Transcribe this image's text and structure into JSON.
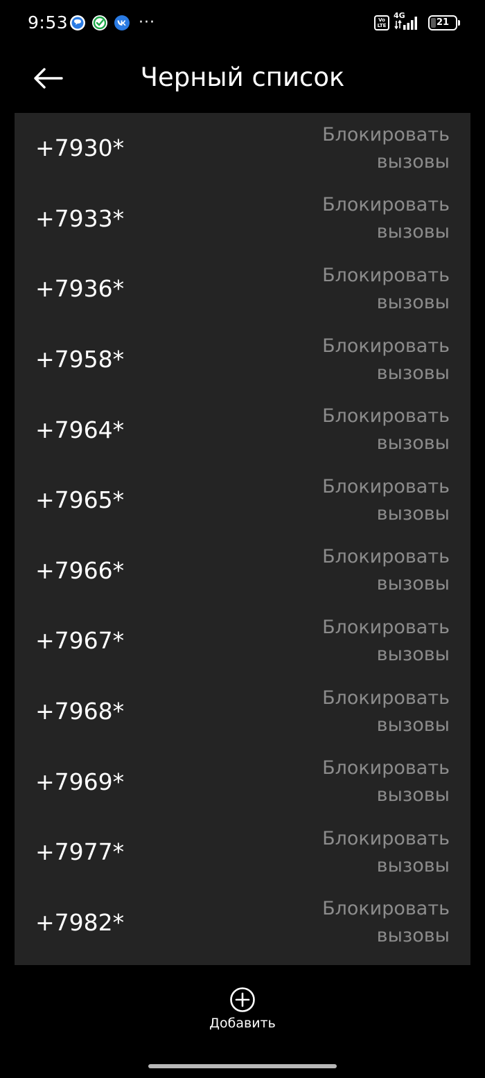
{
  "status_bar": {
    "time": "9:53",
    "network_type": "4G",
    "volte_label": "Vo LTE",
    "battery_level": "21",
    "notification_icons": [
      "chat-bubble-icon",
      "green-check-icon",
      "vk-icon"
    ],
    "more_indicator": "···"
  },
  "header": {
    "back_icon": "arrow-left-icon",
    "title": "Черный список"
  },
  "blacklist": {
    "items": [
      {
        "number": "+7930*",
        "action": "Блокировать вызовы"
      },
      {
        "number": "+7933*",
        "action": "Блокировать вызовы"
      },
      {
        "number": "+7936*",
        "action": "Блокировать вызовы"
      },
      {
        "number": "+7958*",
        "action": "Блокировать вызовы"
      },
      {
        "number": "+7964*",
        "action": "Блокировать вызовы"
      },
      {
        "number": "+7965*",
        "action": "Блокировать вызовы"
      },
      {
        "number": "+7966*",
        "action": "Блокировать вызовы"
      },
      {
        "number": "+7967*",
        "action": "Блокировать вызовы"
      },
      {
        "number": "+7968*",
        "action": "Блокировать вызовы"
      },
      {
        "number": "+7969*",
        "action": "Блокировать вызовы"
      },
      {
        "number": "+7977*",
        "action": "Блокировать вызовы"
      },
      {
        "number": "+7982*",
        "action": "Блокировать вызовы"
      }
    ]
  },
  "bottom_bar": {
    "add_label": "Добавить",
    "add_icon": "plus-circle-icon"
  },
  "colors": {
    "background": "#000000",
    "list_background": "#242424",
    "primary_text": "#ffffff",
    "secondary_text": "#8c8c8c"
  }
}
